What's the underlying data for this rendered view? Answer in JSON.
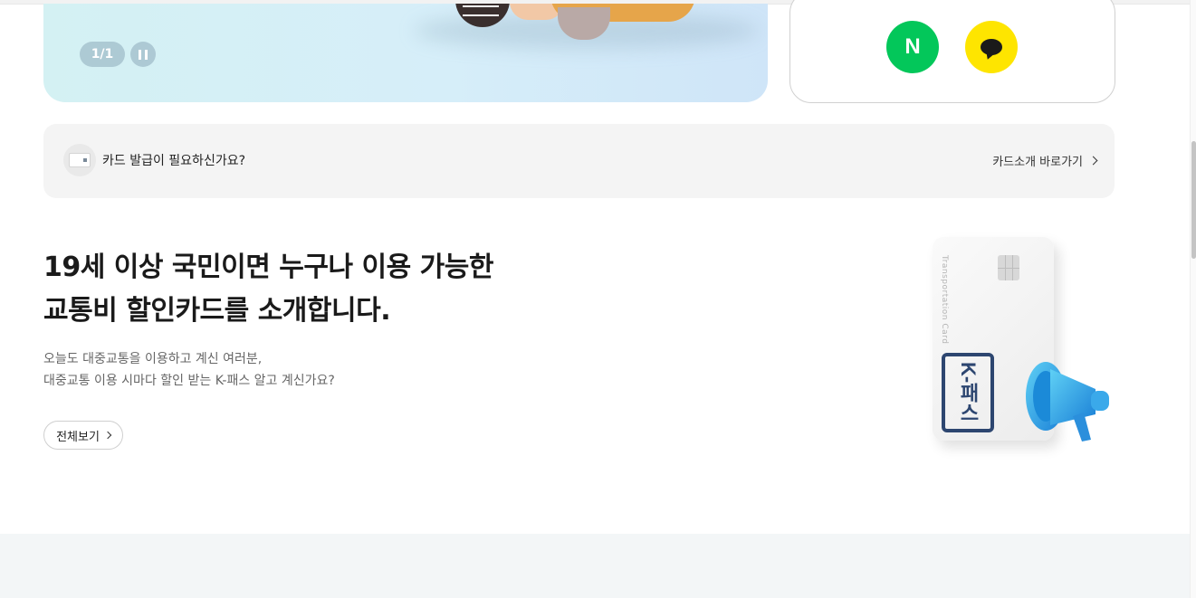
{
  "banner": {
    "slide_counter": "1/1",
    "pause_label": "II"
  },
  "login": {
    "naver_label": "N",
    "naver_color": "#03c75a",
    "kakao_color": "#fee500",
    "kakao_icon": "speech-bubble-icon"
  },
  "card_issue": {
    "question": "카드 발급이 필요하신가요?",
    "link_label": "카드소개 바로가기"
  },
  "intro": {
    "title_line1": "19세 이상 국민이면 누구나 이용 가능한",
    "title_line2": "교통비 할인카드를 소개합니다.",
    "desc_line1": "오늘도 대중교통을 이용하고 계신 여러분,",
    "desc_line2": "대중교통 이용 시마다 할인 받는 K-패스 알고 계신가요?",
    "view_all_label": "전체보기"
  },
  "kpass_card": {
    "vertical_label": "Transportation Card",
    "logo_text": "K-패스",
    "logo_color": "#2d4670"
  }
}
